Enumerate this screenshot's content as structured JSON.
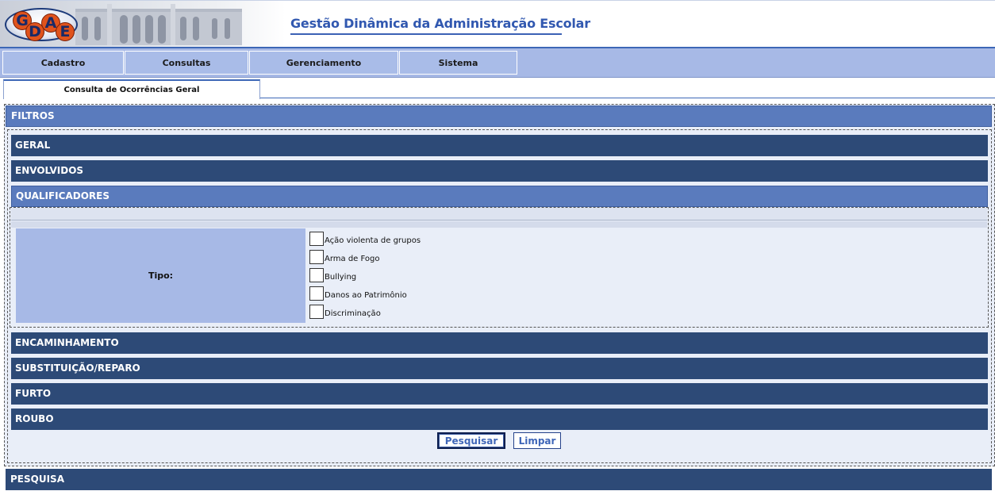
{
  "header": {
    "logo_letters": [
      "G",
      "D",
      "A",
      "E"
    ],
    "title": "Gestão Dinâmica da Administração Escolar"
  },
  "menu": {
    "items": [
      {
        "label": "Cadastro"
      },
      {
        "label": "Consultas"
      },
      {
        "label": "Gerenciamento"
      },
      {
        "label": "Sistema"
      }
    ]
  },
  "tab": {
    "label": "Consulta de Ocorrências Geral"
  },
  "filtros": {
    "title": "FILTROS",
    "sections": {
      "geral": "GERAL",
      "envolvidos": "ENVOLVIDOS",
      "qualificadores": "QUALIFICADORES",
      "encaminhamento": "ENCAMINHAMENTO",
      "substituicao": "SUBSTITUIÇÃO/REPARO",
      "furto": "FURTO",
      "roubo": "ROUBO"
    },
    "tipo": {
      "label": "Tipo:",
      "options": [
        {
          "label": "Ação violenta de grupos",
          "checked": false
        },
        {
          "label": "Arma de Fogo",
          "checked": false
        },
        {
          "label": "Bullying",
          "checked": false
        },
        {
          "label": "Danos ao Patrimônio",
          "checked": false
        },
        {
          "label": "Discriminação",
          "checked": false
        }
      ]
    },
    "buttons": {
      "pesquisar": "Pesquisar",
      "limpar": "Limpar"
    }
  },
  "pesquisa": {
    "title": "PESQUISA"
  },
  "colors": {
    "section_dark": "#2d4a77",
    "section_light": "#5a7bbd",
    "menu_bg": "#a7b9e6",
    "title_blue": "#3158b0",
    "logo_orange": "#e0531c"
  }
}
